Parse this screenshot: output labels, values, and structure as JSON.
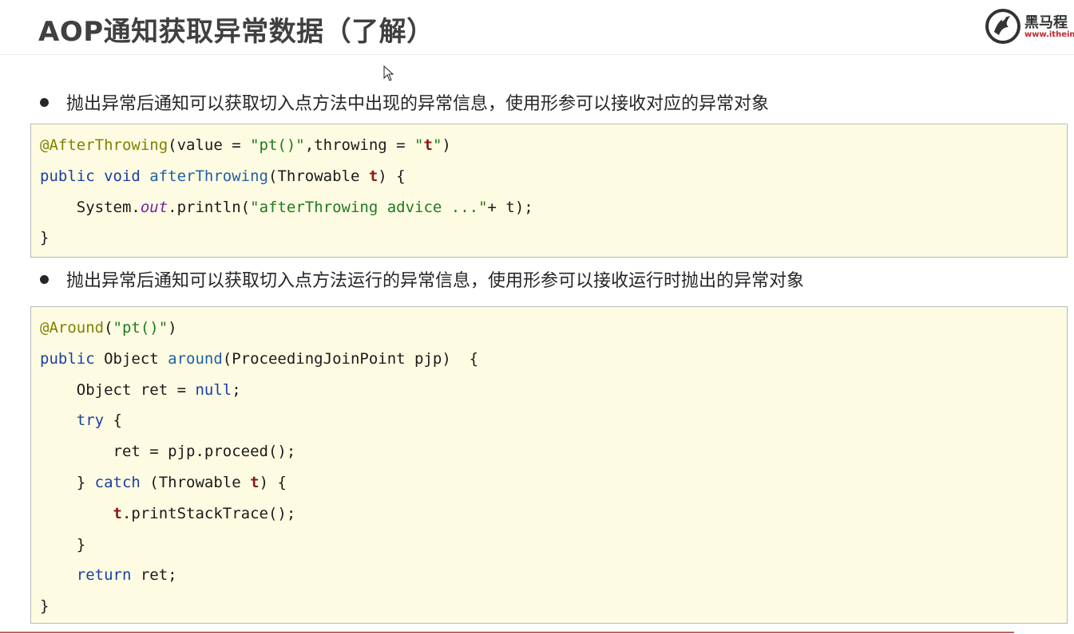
{
  "header": {
    "title": "AOP通知获取异常数据（了解）",
    "logo_text": "黑马程",
    "logo_url": "www.itheim"
  },
  "bullets": [
    "抛出异常后通知可以获取切入点方法中出现的异常信息，使用形参可以接收对应的异常对象",
    "抛出异常后通知可以获取切入点方法运行的异常信息，使用形参可以接收运行时抛出的异常对象"
  ],
  "code_blocks": [
    {
      "lines": [
        [
          [
            "ann",
            "@AfterThrowing"
          ],
          [
            "p",
            "(value = "
          ],
          [
            "str",
            "\"pt()\""
          ],
          [
            "p",
            ",throwing = "
          ],
          [
            "str",
            "\""
          ],
          [
            "bold",
            "t"
          ],
          [
            "str",
            "\""
          ],
          [
            "p",
            ")"
          ]
        ],
        [
          [
            "kw",
            "public void "
          ],
          [
            "fn",
            "afterThrowing"
          ],
          [
            "p",
            "(Throwable "
          ],
          [
            "bold",
            "t"
          ],
          [
            "p",
            ") {"
          ]
        ],
        [
          [
            "p",
            "    System."
          ],
          [
            "field",
            "out"
          ],
          [
            "p",
            ".println("
          ],
          [
            "str",
            "\"afterThrowing advice ...\""
          ],
          [
            "p",
            "+ t);"
          ]
        ],
        [
          [
            "p",
            "}"
          ]
        ]
      ]
    },
    {
      "lines": [
        [
          [
            "ann",
            "@Around"
          ],
          [
            "p",
            "("
          ],
          [
            "str",
            "\"pt()\""
          ],
          [
            "p",
            ")"
          ]
        ],
        [
          [
            "kw",
            "public "
          ],
          [
            "p",
            "Object "
          ],
          [
            "fn",
            "around"
          ],
          [
            "p",
            "(ProceedingJoinPoint pjp)  {"
          ]
        ],
        [
          [
            "p",
            "    Object ret = "
          ],
          [
            "kw",
            "null"
          ],
          [
            "p",
            ";"
          ]
        ],
        [
          [
            "p",
            "    "
          ],
          [
            "kw",
            "try"
          ],
          [
            "p",
            " {"
          ]
        ],
        [
          [
            "p",
            "        ret = pjp.proceed();"
          ]
        ],
        [
          [
            "p",
            "    } "
          ],
          [
            "kw",
            "catch"
          ],
          [
            "p",
            " (Throwable "
          ],
          [
            "bold",
            "t"
          ],
          [
            "p",
            ") {"
          ]
        ],
        [
          [
            "p",
            "        "
          ],
          [
            "bold",
            "t"
          ],
          [
            "p",
            ".printStackTrace();"
          ]
        ],
        [
          [
            "p",
            "    }"
          ]
        ],
        [
          [
            "p",
            "    "
          ],
          [
            "kw",
            "return"
          ],
          [
            "p",
            " ret;"
          ]
        ],
        [
          [
            "p",
            "}"
          ]
        ]
      ]
    }
  ],
  "colors": {
    "code_background": "#fdfce2",
    "annotation": "#808000",
    "keyword": "#1a3ea6",
    "string": "#1f7a1f",
    "highlight_param": "#8b1a1a"
  }
}
